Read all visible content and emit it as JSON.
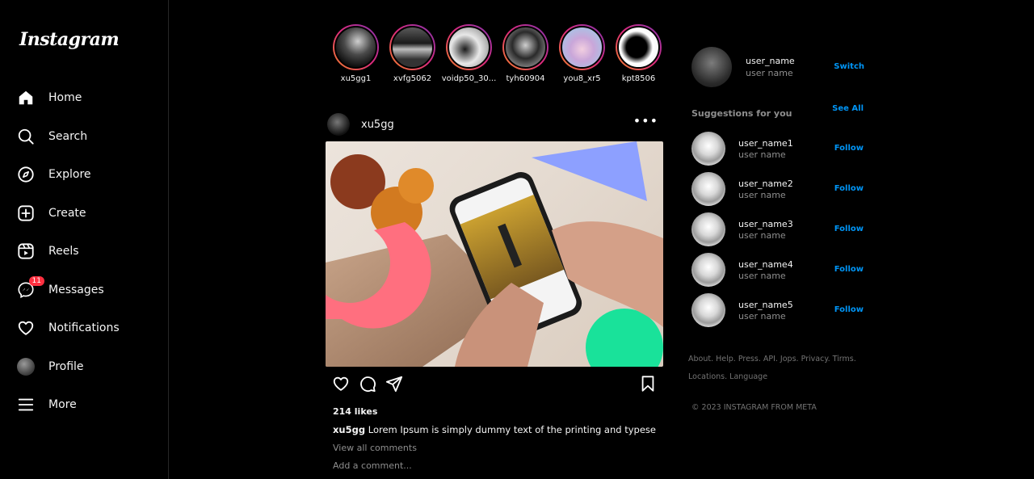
{
  "sidebar": {
    "logo": "Instagram",
    "items": [
      {
        "label": "Home",
        "icon": "home-icon"
      },
      {
        "label": "Search",
        "icon": "search-icon"
      },
      {
        "label": "Explore",
        "icon": "compass-icon"
      },
      {
        "label": "Create",
        "icon": "plus-square-icon"
      },
      {
        "label": "Reels",
        "icon": "reels-icon"
      },
      {
        "label": "Messages",
        "icon": "messenger-icon",
        "badge": "11"
      },
      {
        "label": "Notifications",
        "icon": "heart-icon"
      },
      {
        "label": "Profile",
        "icon": "avatar"
      },
      {
        "label": "More",
        "icon": "menu-icon"
      }
    ]
  },
  "stories": [
    {
      "name": "xu5gg1"
    },
    {
      "name": "xvfg5062"
    },
    {
      "name": "voidp50_30..."
    },
    {
      "name": "tyh60904"
    },
    {
      "name": "you8_xr5"
    },
    {
      "name": "kpt8506"
    }
  ],
  "post": {
    "username": "xu5gg",
    "more": "•••",
    "likes": "214 likes",
    "caption_user": "xu5gg",
    "caption_text": " Lorem Ipsum is simply dummy text of the printing and typesetti...",
    "view_comments": "View all comments",
    "comment_placeholder": "Add a comment..."
  },
  "right": {
    "me_name": "user_name",
    "me_sub": "user name",
    "switch": "Switch",
    "suggestions_title": "Suggestions for you",
    "see_all": "See All",
    "suggestions": [
      {
        "name": "user_name1",
        "sub": "user name",
        "action": "Follow"
      },
      {
        "name": "user_name2",
        "sub": "user name",
        "action": "Follow"
      },
      {
        "name": "user_name3",
        "sub": "user name",
        "action": "Follow"
      },
      {
        "name": "user_name4",
        "sub": "user name",
        "action": "Follow"
      },
      {
        "name": "user_name5",
        "sub": "user name",
        "action": "Follow"
      }
    ],
    "footer_line1": "About. Help. Press. API. Jops. Privacy. Tirms.",
    "footer_line2": "Locations. Language",
    "copyright": "© 2023 INSTAGRAM FROM META"
  },
  "colors": {
    "background": "#000000",
    "accent_blue": "#0095f6",
    "badge_red": "#ff3040",
    "muted": "#8e8e8e"
  }
}
